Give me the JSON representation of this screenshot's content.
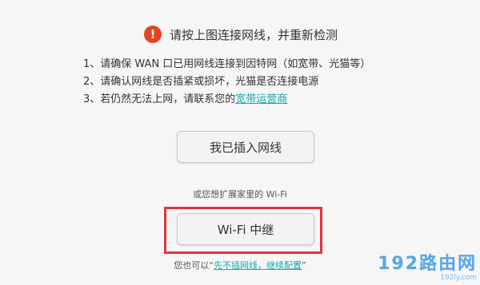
{
  "warning": {
    "icon": "!",
    "title": "请按上图连接网线，并重新检测",
    "color": "#e8431e"
  },
  "steps": {
    "step1": "1、请确保 WAN 口已用网线连接到因特网（如宽带、光猫等）",
    "step2": "2、请确认网线是否插紧或损坏，光猫是否连接电源",
    "step3_prefix": "3、若仍然无法上网，请联系您的",
    "step3_link": "宽带运营商"
  },
  "buttons": {
    "plugged_label": "我已插入网线",
    "wifi_repeater_label": "Wi-Fi 中继"
  },
  "hints": {
    "extend_wifi": "或您想扩展家里的 Wi-Fi",
    "skip_prefix": "您也可以“",
    "skip_link": "先不插网线，继续配置",
    "skip_suffix": "”"
  },
  "watermark": {
    "main": "192路由网",
    "sub": "192ly.com"
  },
  "colors": {
    "link": "#1aa7b0",
    "highlight": "#e0343a"
  }
}
